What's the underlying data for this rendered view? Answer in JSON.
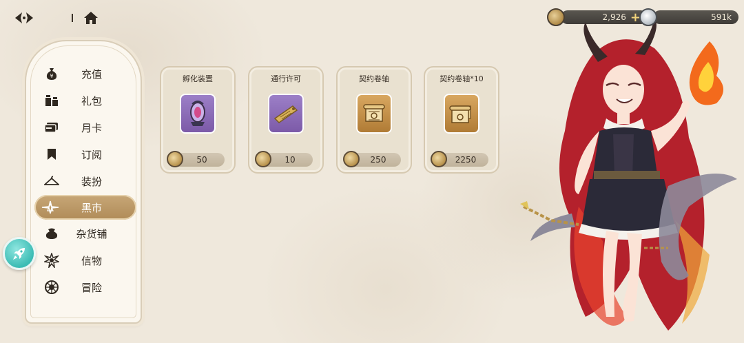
{
  "topbar": {
    "back_icon": "back-arrow-icon",
    "home_icon": "home-icon",
    "gold": "2,926",
    "gold_plus": "+",
    "silver": "591k"
  },
  "sidebar": {
    "items": [
      {
        "label": "充值",
        "icon": "money-bag-icon"
      },
      {
        "label": "礼包",
        "icon": "gift-icon"
      },
      {
        "label": "月卡",
        "icon": "card-icon"
      },
      {
        "label": "订阅",
        "icon": "bookmark-icon"
      },
      {
        "label": "装扮",
        "icon": "hanger-icon"
      },
      {
        "label": "黑市",
        "icon": "compass-star-icon",
        "active": true
      },
      {
        "label": "杂货铺",
        "icon": "pouch-icon"
      },
      {
        "label": "信物",
        "icon": "emblem-icon"
      },
      {
        "label": "冒险",
        "icon": "wheel-icon"
      }
    ]
  },
  "shop": {
    "items": [
      {
        "name": "孵化装置",
        "price": "50",
        "icon": "incubator-icon"
      },
      {
        "name": "通行许可",
        "price": "10",
        "icon": "permit-ticket-icon"
      },
      {
        "name": "契约卷轴",
        "price": "250",
        "icon": "scroll-icon"
      },
      {
        "name": "契约卷轴*10",
        "price": "2250",
        "icon": "scroll-bundle-icon"
      }
    ]
  },
  "colors": {
    "background": "#efe8dc",
    "active_tab": "#b89463",
    "rocket": "#3bbcb4"
  }
}
